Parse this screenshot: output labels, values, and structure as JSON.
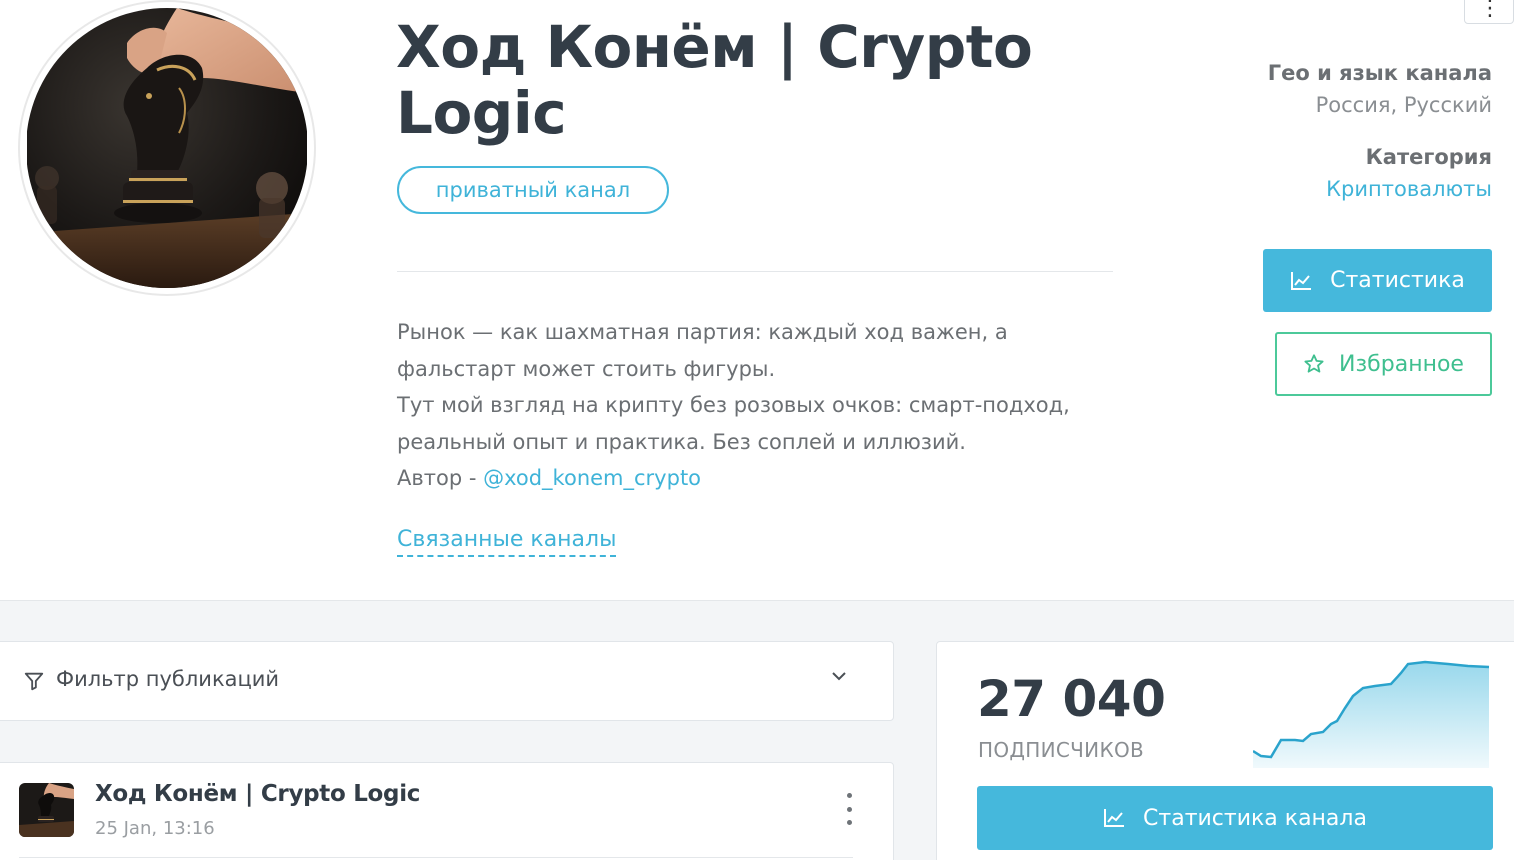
{
  "channel": {
    "title": "Ход Конём | Crypto Logic",
    "badge": "приватный канал",
    "description_lines": [
      "Рынок — как шахматная партия: каждый ход важен, а",
      "фальстарт может стоить фигуры.",
      "Тут мой взгляд на крипту без розовых очков: смарт-подход,",
      "реальный опыт и практика. Без соплей и иллюзий."
    ],
    "author_prefix": "Автор - ",
    "author_link": "@xod_konem_crypto",
    "related_link": "Связанные каналы"
  },
  "meta": {
    "geo_heading": "Гео и язык канала",
    "geo_value": "Россия, Русский",
    "category_heading": "Категория",
    "category_value": "Криптовалюты"
  },
  "actions": {
    "stats_label": "Статистика",
    "favorite_label": "Избранное"
  },
  "filter": {
    "label": "Фильтр публикаций"
  },
  "post": {
    "channel_name": "Ход Конём | Crypto Logic",
    "timestamp": "25 Jan, 13:16"
  },
  "subscribers": {
    "count": "27 040",
    "label": "подписчиков",
    "button_label": "Статистика канала"
  },
  "colors": {
    "accent_blue": "#45b8dc",
    "accent_green": "#4cc99a",
    "title_dark": "#333d47"
  },
  "icons": {
    "top_menu": "kebab-menu-icon",
    "stats": "line-chart-icon",
    "favorite": "star-outline-icon",
    "filter": "funnel-icon",
    "expand": "chevron-down-icon",
    "post_menu": "kebab-menu-icon"
  }
}
